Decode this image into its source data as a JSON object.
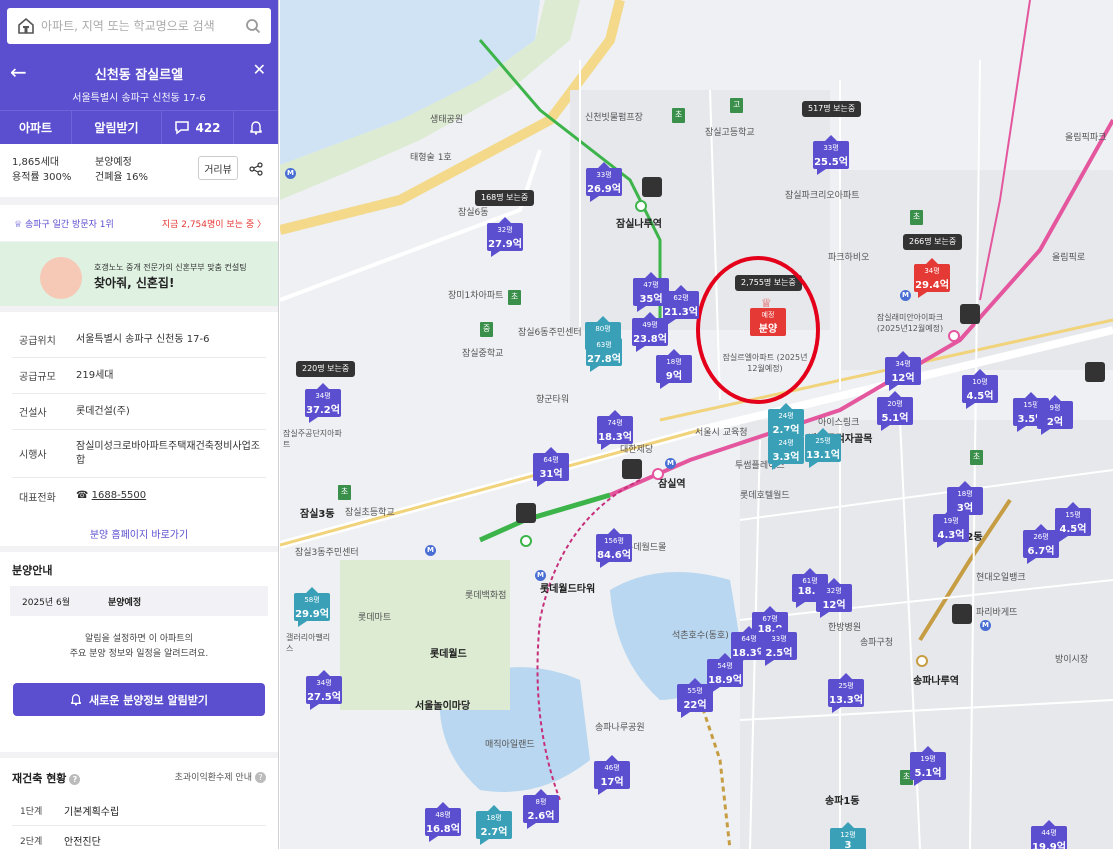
{
  "search": {
    "placeholder": "아파트, 지역 또는 학교명으로 검색"
  },
  "header": {
    "title": "신천동 잠실르엘",
    "address": "서울특별시 송파구 신천동 17-6"
  },
  "tabs": {
    "apt": "아파트",
    "alarm": "알림받기",
    "comments": "422"
  },
  "summary": {
    "households": "1,865세대",
    "floor_area_ratio": "용적률 300%",
    "status": "분양예정",
    "coverage_ratio": "건폐율 16%",
    "distance_btn": "거리뷰"
  },
  "visit": {
    "rank": "송파구 일간 방문자 1위",
    "viewers": "지금 2,754명이 보는 중 〉"
  },
  "banner": {
    "line1": "호갱노노 중개 전문가의 신혼부부 맞춤 컨설팅",
    "line2": "찾아줘, 신혼집!"
  },
  "info": {
    "rows": [
      {
        "k": "공급위치",
        "v": "서울특별시 송파구 신천동 17-6"
      },
      {
        "k": "공급규모",
        "v": "219세대"
      },
      {
        "k": "건설사",
        "v": "롯데건설(주)"
      },
      {
        "k": "시행사",
        "v": "잠실미성크로바아파트주택재건축정비사업조합"
      },
      {
        "k": "대표전화",
        "v": "1688-5500"
      }
    ],
    "homepage": "분양 홈페이지 바로가기"
  },
  "presale": {
    "title": "분양안내",
    "date": "2025년 6월",
    "status": "분양예정",
    "note1": "알림을 설정하면 이 아파트의",
    "note2": "주요 분양 정보와 일정을 알려드려요.",
    "button": "새로운 분양정보 알림받기"
  },
  "rebuild": {
    "title": "재건축 현황",
    "link": "초과이익환수제 안내",
    "steps": [
      {
        "n": "1단계",
        "v": "기본계획수립"
      },
      {
        "n": "2단계",
        "v": "안전진단"
      }
    ]
  },
  "map": {
    "labels": [
      "생태공원",
      "신천빗물펌프장",
      "잠실고등학교",
      "태형술 1호",
      "잠실파크리오아파트",
      "잠실6동",
      "잠실나루역",
      "장미1차아파트",
      "잠실6동주민센터",
      "파크하비오",
      "잠실중학교",
      "향군타워",
      "잠실르엘아파트 (2025년12월예정)",
      "서울시 교육청",
      "잠실역",
      "대한제당",
      "투썸플레이스",
      "잠실3동",
      "잠실3동주민센터",
      "잠실초등학교",
      "롯데마트",
      "롯데백화점",
      "롯데월드",
      "롯데월드타워",
      "롯데월드몰",
      "석촌호수(동호)",
      "서울놀이마당",
      "매직아일랜드",
      "송파나루공원",
      "잠실래미안아이파크 (2025년12월예정)",
      "올림픽로",
      "방이동먹자골목",
      "송파구청",
      "올림픽파크",
      "송파나루역",
      "송파1동",
      "방이2동",
      "방이시장",
      "현대오일뱅크",
      "파리바게뜨",
      "한방병원",
      "롯데호텔월드",
      "아이스링크",
      "잠실주공단지아파트",
      "갤러리아팰리스"
    ],
    "hotspot": {
      "viewers": "2,755명 보는중",
      "tag": "예정",
      "label": "분양"
    },
    "markers": [
      {
        "size": "33평",
        "price": "26.9억",
        "color": "#5b4fcf"
      },
      {
        "size": "32평",
        "price": "27.9억",
        "color": "#5b4fcf"
      },
      {
        "size": "33평",
        "price": "25.5억",
        "color": "#5b4fcf"
      },
      {
        "size": "47평",
        "price": "35억",
        "color": "#5b4fcf"
      },
      {
        "size": "62평",
        "price": "21.3억",
        "color": "#5b4fcf"
      },
      {
        "size": "49평",
        "price": "23.8억",
        "color": "#5b4fcf"
      },
      {
        "size": "80평",
        "price": "1",
        "color": "#3aa0b8"
      },
      {
        "size": "63평",
        "price": "27.8억",
        "color": "#3aa0b8"
      },
      {
        "size": "18평",
        "price": "9억",
        "color": "#5b4fcf"
      },
      {
        "size": "34평",
        "price": "29.4억",
        "color": "#e53935"
      },
      {
        "size": "34평",
        "price": "37.2억",
        "color": "#5b4fcf"
      },
      {
        "size": "74평",
        "price": "18.3억",
        "color": "#5b4fcf"
      },
      {
        "size": "64평",
        "price": "31억",
        "color": "#5b4fcf"
      },
      {
        "size": "24평",
        "price": "2.7억",
        "color": "#3aa0b8"
      },
      {
        "size": "24평",
        "price": "3.3억",
        "color": "#3aa0b8"
      },
      {
        "size": "25평",
        "price": "13.1억",
        "color": "#3aa0b8"
      },
      {
        "size": "34평",
        "price": "12억",
        "color": "#5b4fcf"
      },
      {
        "size": "20평",
        "price": "5.1억",
        "color": "#5b4fcf"
      },
      {
        "size": "10평",
        "price": "4.5억",
        "color": "#5b4fcf"
      },
      {
        "size": "15평",
        "price": "3.5억",
        "color": "#5b4fcf"
      },
      {
        "size": "9평",
        "price": "2억",
        "color": "#5b4fcf"
      },
      {
        "size": "18평",
        "price": "3억",
        "color": "#5b4fcf"
      },
      {
        "size": "19평",
        "price": "4.3억",
        "color": "#5b4fcf"
      },
      {
        "size": "15평",
        "price": "4.5억",
        "color": "#5b4fcf"
      },
      {
        "size": "26평",
        "price": "6.7억",
        "color": "#5b4fcf"
      },
      {
        "size": "156평",
        "price": "84.6억",
        "color": "#5b4fcf"
      },
      {
        "size": "58평",
        "price": "29.9억",
        "color": "#3aa0b8"
      },
      {
        "size": "61평",
        "price": "18.2",
        "color": "#5b4fcf"
      },
      {
        "size": "32평",
        "price": "12억",
        "color": "#5b4fcf"
      },
      {
        "size": "67평",
        "price": "18.8",
        "color": "#5b4fcf"
      },
      {
        "size": "64평",
        "price": "18.3억",
        "color": "#5b4fcf"
      },
      {
        "size": "33평",
        "price": "2.5억",
        "color": "#5b4fcf"
      },
      {
        "size": "54평",
        "price": "18.9억",
        "color": "#5b4fcf"
      },
      {
        "size": "55평",
        "price": "22억",
        "color": "#5b4fcf"
      },
      {
        "size": "25평",
        "price": "13.3억",
        "color": "#5b4fcf"
      },
      {
        "size": "34평",
        "price": "27.5억",
        "color": "#5b4fcf"
      },
      {
        "size": "46평",
        "price": "17억",
        "color": "#5b4fcf"
      },
      {
        "size": "48평",
        "price": "16.8억",
        "color": "#5b4fcf"
      },
      {
        "size": "18평",
        "price": "2.7억",
        "color": "#3aa0b8"
      },
      {
        "size": "8평",
        "price": "2.6억",
        "color": "#5b4fcf"
      },
      {
        "size": "19평",
        "price": "5.1억",
        "color": "#5b4fcf"
      },
      {
        "size": "12평",
        "price": "3",
        "color": "#3aa0b8"
      },
      {
        "size": "44평",
        "price": "19.9억",
        "color": "#5b4fcf"
      }
    ],
    "viewbadges": [
      "517명 보는중",
      "168명 보는중",
      "266명 보는중",
      "220명 보는중"
    ]
  }
}
